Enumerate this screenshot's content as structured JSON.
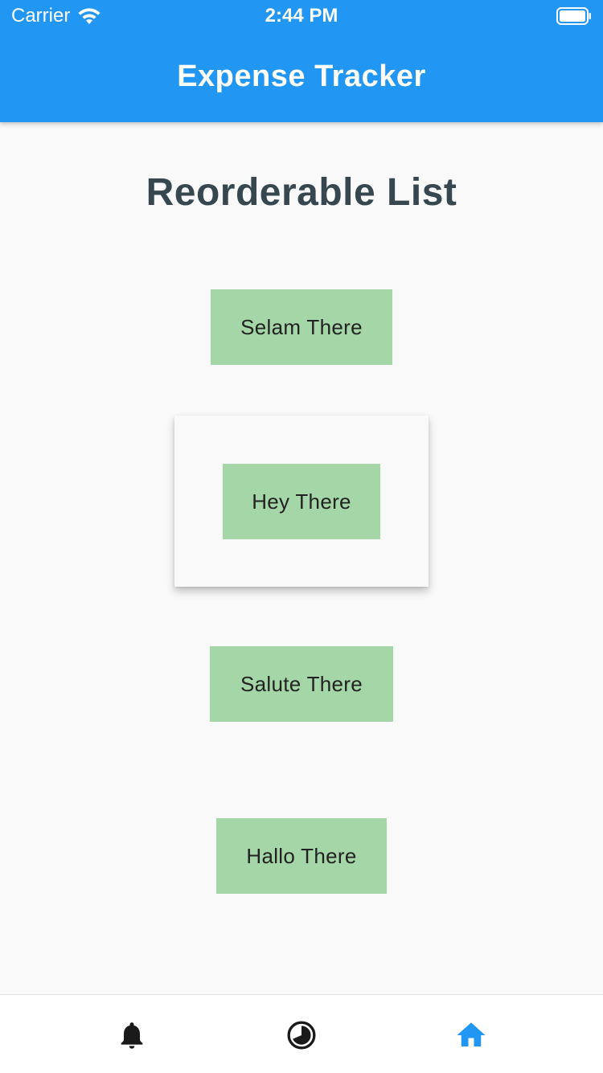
{
  "status_bar": {
    "carrier": "Carrier",
    "time": "2:44 PM",
    "icons": [
      "wifi-icon",
      "battery-icon"
    ]
  },
  "app_bar": {
    "title": "Expense Tracker",
    "color": "#2196f3"
  },
  "page": {
    "heading": "Reorderable List",
    "heading_color": "#37474f"
  },
  "list": {
    "item_color": "#a5d6a7",
    "items": [
      {
        "label": "Selam There",
        "dragging": false
      },
      {
        "label": "Hey There",
        "dragging": true
      },
      {
        "label": "Salute There",
        "dragging": false
      },
      {
        "label": "Hallo There",
        "dragging": false
      }
    ]
  },
  "bottom_nav": {
    "items": [
      {
        "icon": "bell-icon",
        "active": false
      },
      {
        "icon": "pie-chart-icon",
        "active": false
      },
      {
        "icon": "home-icon",
        "active": true
      }
    ],
    "active_color": "#2196f3",
    "inactive_color": "#1a1a1a"
  }
}
